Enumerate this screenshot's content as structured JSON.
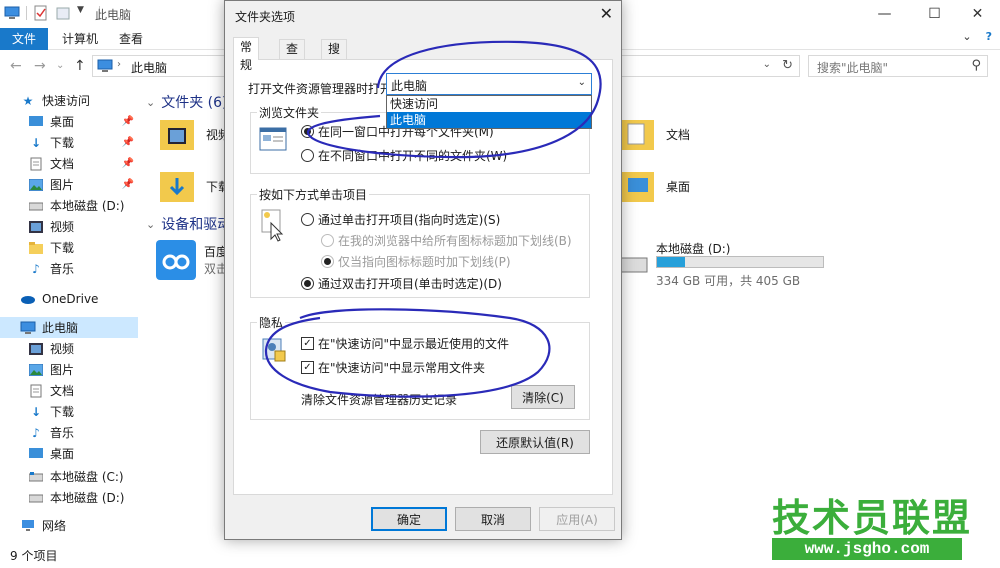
{
  "window": {
    "title": "此电脑"
  },
  "ribbon": {
    "tabs": [
      "文件",
      "计算机",
      "查看"
    ]
  },
  "address": {
    "path": "此电脑",
    "search_placeholder": "搜索\"此电脑\""
  },
  "sidebar": {
    "items": [
      {
        "label": "快速访问",
        "icon": "star-icon"
      },
      {
        "label": "桌面",
        "icon": "desktop-icon",
        "pinned": true
      },
      {
        "label": "下载",
        "icon": "download-icon",
        "pinned": true
      },
      {
        "label": "文档",
        "icon": "document-icon",
        "pinned": true
      },
      {
        "label": "图片",
        "icon": "picture-icon",
        "pinned": true
      },
      {
        "label": "本地磁盘 (D:)",
        "icon": "drive-icon"
      },
      {
        "label": "视频",
        "icon": "video-icon"
      },
      {
        "label": "下载",
        "icon": "folder-icon"
      },
      {
        "label": "音乐",
        "icon": "music-icon"
      },
      {
        "label": "OneDrive",
        "icon": "cloud-icon"
      },
      {
        "label": "此电脑",
        "icon": "computer-icon"
      },
      {
        "label": "视频",
        "icon": "video-icon"
      },
      {
        "label": "图片",
        "icon": "picture-icon"
      },
      {
        "label": "文档",
        "icon": "document-icon"
      },
      {
        "label": "下载",
        "icon": "download-icon"
      },
      {
        "label": "音乐",
        "icon": "music-icon"
      },
      {
        "label": "桌面",
        "icon": "desktop-icon"
      },
      {
        "label": "本地磁盘 (C:)",
        "icon": "drive-icon"
      },
      {
        "label": "本地磁盘 (D:)",
        "icon": "drive-icon"
      },
      {
        "label": "网络",
        "icon": "network-icon"
      }
    ]
  },
  "content": {
    "folders_header": "文件夹 (6)",
    "devices_header": "设备和驱动",
    "folders": [
      "视频",
      "下载",
      "文档",
      "桌面"
    ],
    "baidu": {
      "name": "百度",
      "sub": "双击"
    },
    "drive": {
      "name": "本地磁盘 (D:)",
      "info": "334 GB 可用，共 405 GB",
      "used_fraction": 0.17
    }
  },
  "status": {
    "item_count": "9 个项目"
  },
  "dialog": {
    "title": "文件夹选项",
    "tabs": [
      "常规",
      "查看",
      "搜索"
    ],
    "open_label": "打开文件资源管理器时打开:",
    "combo_value": "此电脑",
    "combo_options": [
      "快速访问",
      "此电脑"
    ],
    "browse": {
      "legend": "浏览文件夹",
      "opt_same": "在同一窗口中打开每个文件夹(M)",
      "opt_new": "在不同窗口中打开不同的文件夹(W)"
    },
    "click": {
      "legend": "按如下方式单击项目",
      "opt_single": "通过单击打开项目(指向时选定)(S)",
      "opt_browser": "在我的浏览器中给所有图标标题加下划线(B)",
      "opt_point": "仅当指向图标标题时加下划线(P)",
      "opt_double": "通过双击打开项目(单击时选定)(D)"
    },
    "privacy": {
      "legend": "隐私",
      "chk_recent": "在\"快速访问\"中显示最近使用的文件",
      "chk_frequent": "在\"快速访问\"中显示常用文件夹",
      "clear_label": "清除文件资源管理器历史记录",
      "clear_button": "清除(C)"
    },
    "restore_button": "还原默认值(R)",
    "ok": "确定",
    "cancel": "取消",
    "apply": "应用(A)"
  },
  "watermark": {
    "main": "技术员联盟",
    "sub": "www.jsgho.com"
  },
  "colors": {
    "accent": "#1979ca",
    "annotation": "#2a2ab8",
    "watermark": "#3bae3b"
  }
}
